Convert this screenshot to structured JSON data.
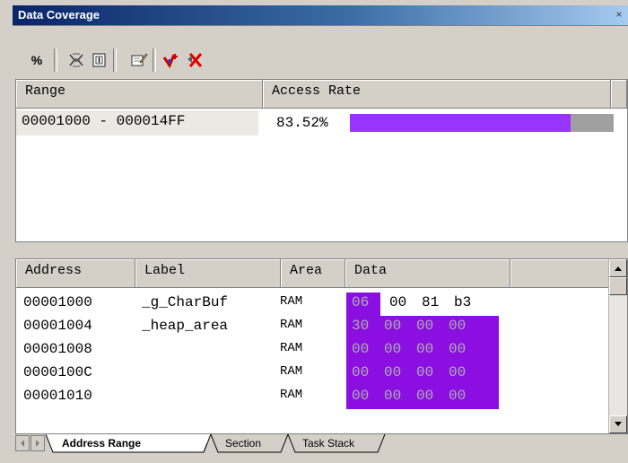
{
  "window": {
    "title": "Data Coverage",
    "close_glyph": "×"
  },
  "toolbar": {
    "buttons": [
      {
        "icon": "percent-icon",
        "glyph": "%"
      },
      {
        "icon": "chip-icon",
        "glyph": ""
      },
      {
        "icon": "memory-icon",
        "glyph": ""
      },
      {
        "icon": "edit-range-icon",
        "glyph": ""
      },
      {
        "icon": "add-range-icon",
        "glyph": ""
      },
      {
        "icon": "delete-range-icon",
        "glyph": ""
      }
    ]
  },
  "range_table": {
    "headers": [
      "Range",
      "Access Rate"
    ],
    "rows": [
      {
        "range": "00001000 - 000014FF",
        "rate": "83.52%",
        "rate_fraction": 0.8352
      }
    ],
    "bar_fill_color": "#9933ff",
    "bar_rest_color": "#a0a0a0"
  },
  "data_table": {
    "headers": [
      "Address",
      "Label",
      "Area",
      "Data"
    ],
    "rows": [
      {
        "address": "00001000",
        "label": "_g_CharBuf",
        "area": "RAM",
        "data": [
          "06",
          "00",
          "81",
          "b3"
        ],
        "accessed": [
          true,
          false,
          false,
          false
        ]
      },
      {
        "address": "00001004",
        "label": "_heap_area",
        "area": "RAM",
        "data": [
          "30",
          "00",
          "00",
          "00"
        ],
        "accessed": [
          true,
          true,
          true,
          true
        ]
      },
      {
        "address": "00001008",
        "label": "",
        "area": "RAM",
        "data": [
          "00",
          "00",
          "00",
          "00"
        ],
        "accessed": [
          true,
          true,
          true,
          true
        ]
      },
      {
        "address": "0000100C",
        "label": "",
        "area": "RAM",
        "data": [
          "00",
          "00",
          "00",
          "00"
        ],
        "accessed": [
          true,
          true,
          true,
          true
        ]
      },
      {
        "address": "00001010",
        "label": "",
        "area": "RAM",
        "data": [
          "00",
          "00",
          "00",
          "00"
        ],
        "accessed": [
          true,
          true,
          true,
          true
        ]
      }
    ],
    "accessed_color": "#8a0fe0"
  },
  "tabs": [
    {
      "label": "Address Range",
      "active": true
    },
    {
      "label": "Section",
      "active": false
    },
    {
      "label": "Task Stack",
      "active": false
    }
  ]
}
